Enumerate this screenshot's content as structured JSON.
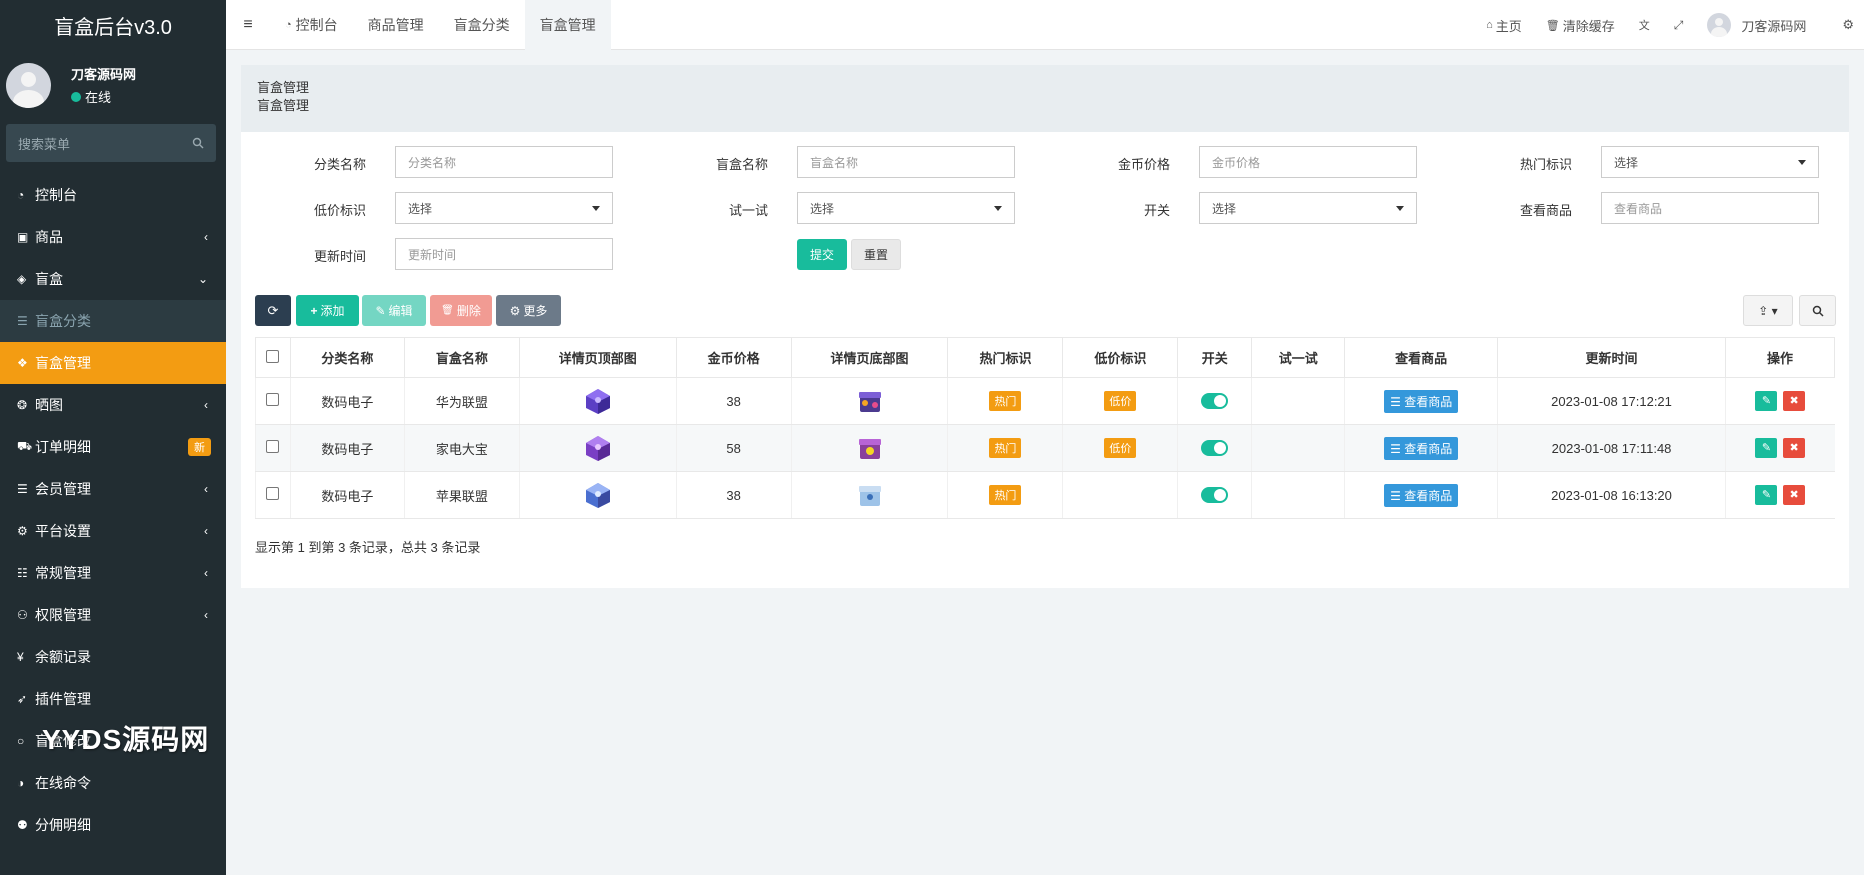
{
  "app": {
    "title": "盲盒后台v3.0"
  },
  "user": {
    "name": "刀客源码网",
    "status": "在线"
  },
  "sidebar": {
    "search_placeholder": "搜索菜单",
    "items": [
      {
        "label": "控制台",
        "icon": "dashboard-icon"
      },
      {
        "label": "商品",
        "icon": "shopping-bag-icon"
      },
      {
        "label": "盲盒",
        "icon": "cube-icon"
      },
      {
        "label": "盲盒分类",
        "icon": "list-icon"
      },
      {
        "label": "盲盒管理",
        "icon": "cubes-icon"
      },
      {
        "label": "晒图",
        "icon": "dropbox-icon"
      },
      {
        "label": "订单明细",
        "icon": "cart-icon",
        "badge": "新"
      },
      {
        "label": "会员管理",
        "icon": "list-icon"
      },
      {
        "label": "平台设置",
        "icon": "gear-icon"
      },
      {
        "label": "常规管理",
        "icon": "database-icon"
      },
      {
        "label": "权限管理",
        "icon": "group-icon"
      },
      {
        "label": "余额记录",
        "icon": "yen-icon"
      },
      {
        "label": "插件管理",
        "icon": "rocket-icon"
      },
      {
        "label": "盲盒修改",
        "icon": "circle-icon"
      },
      {
        "label": "在线命令",
        "icon": "adjust-icon"
      },
      {
        "label": "分佣明细",
        "icon": "users-icon"
      }
    ]
  },
  "navbar": {
    "tabs": [
      "控制台",
      "商品管理",
      "盲盒分类",
      "盲盒管理"
    ],
    "home": "主页",
    "clear_cache": "清除缓存",
    "username": "刀客源码网"
  },
  "panel": {
    "title": "盲盒管理",
    "subtitle": "盲盒管理"
  },
  "filters": {
    "category_label": "分类名称",
    "category_ph": "分类名称",
    "name_label": "盲盒名称",
    "name_ph": "盲盒名称",
    "price_label": "金币价格",
    "price_ph": "金币价格",
    "hot_label": "热门标识",
    "hot_value": "选择",
    "low_label": "低价标识",
    "low_value": "选择",
    "try_label": "试一试",
    "try_value": "选择",
    "switch_label": "开关",
    "switch_value": "选择",
    "goods_label": "查看商品",
    "goods_ph": "查看商品",
    "time_label": "更新时间",
    "time_ph": "更新时间",
    "submit": "提交",
    "reset": "重置"
  },
  "toolbar": {
    "add": "添加",
    "edit": "编辑",
    "delete": "删除",
    "more": "更多"
  },
  "table": {
    "headers": [
      "分类名称",
      "盲盒名称",
      "详情页顶部图",
      "金币价格",
      "详情页底部图",
      "热门标识",
      "低价标识",
      "开关",
      "试一试",
      "查看商品",
      "更新时间",
      "操作"
    ],
    "rows": [
      {
        "category": "数码电子",
        "name": "华为联盟",
        "price": "38",
        "hot": "热门",
        "low": "低价",
        "goods": "查看商品",
        "time": "2023-01-08 17:12:21"
      },
      {
        "category": "数码电子",
        "name": "家电大宝",
        "price": "58",
        "hot": "热门",
        "low": "低价",
        "goods": "查看商品",
        "time": "2023-01-08 17:11:48"
      },
      {
        "category": "数码电子",
        "name": "苹果联盟",
        "price": "38",
        "hot": "热门",
        "low": "",
        "goods": "查看商品",
        "time": "2023-01-08 16:13:20"
      }
    ],
    "footer": "显示第 1 到第 3 条记录，总共 3 条记录"
  },
  "watermark": "YYDS源码网",
  "colors": {
    "sidebar": "#222d32",
    "active": "#f39c12",
    "success": "#18bc9c",
    "danger": "#e74c3c",
    "info": "#3498db"
  }
}
